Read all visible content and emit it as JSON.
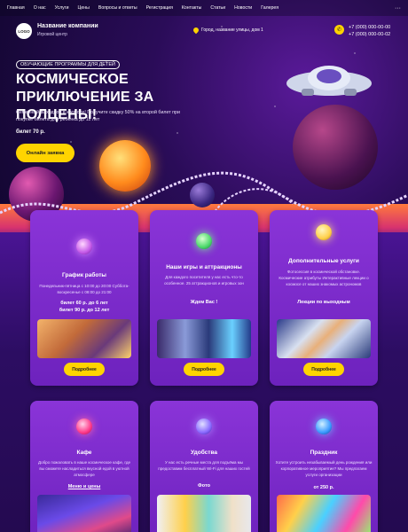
{
  "nav": {
    "items": [
      "Главная",
      "О нас",
      "Услуги",
      "Цены",
      "Вопросы и ответы",
      "Регистрация",
      "Контакты",
      "Статьи",
      "Новости",
      "Галерея"
    ],
    "more": "···"
  },
  "header": {
    "logo": "LOGO",
    "company_name": "Название компании",
    "company_sub": "Игровой центр",
    "address": "Город, название улицы, дом 1",
    "phone_1": "+7 (000) 000-00-00",
    "phone_2": "+7 (000) 000-00-02"
  },
  "hero": {
    "badge": "ОБУЧАЮЩИЕ ПРОГРАММЫ ДЛЯ ДЕТЕЙ",
    "title": "КОСМИЧЕСКОЕ ПРИКЛЮЧЕНИЕ ЗА ПОЛЦЕНЫ!",
    "description": "Семейный выходной в космосе! Получите скидку 50% на второй билет при покупке билета для ребенка до 12 лет",
    "price": "билет 70 р.",
    "cta": "Онлайн заявка"
  },
  "cards": [
    {
      "title": "График работы",
      "text": "Понедельник-пятница с 10:00 до 20:00 Суббота-воскресенье с 08:00 до 21:00",
      "strong": [
        "билет 60 р. до 6 лет",
        "билет 90 р. до 12 лет"
      ],
      "button": "Подробнее"
    },
    {
      "title": "Наши игры и аттракционы",
      "text": "Для каждого посетителя у нас есть что-то особенное. 25 аттракционов и игровых зон",
      "strong": [
        "Ждем Вас !"
      ],
      "button": "Подробнее"
    },
    {
      "title": "Дополнительные услуги",
      "text": "Фотосессия в космической обстановке. Космические атрибуты Интерактивные лекции о космосе от наших знакомых астрономов",
      "strong": [
        "Лекции по выходным"
      ],
      "button": "Подробнее"
    },
    {
      "title": "Кафе",
      "text": "Добро пожаловать в наше космическое кафе, где вы сможете насладиться вкусной едой в уютной атмосфере",
      "link": "Меню и цены"
    },
    {
      "title": "Удобства",
      "text": "У нас есть речные места для подъёма мы предоставим бесплатный Wi-Fi для наших гостей",
      "strong": [
        "Фото"
      ]
    },
    {
      "title": "Праздник",
      "text": "Хотите устроить незабываемый день рождения или корпоративное мероприятие? Мы предлагаем услуги организации",
      "strong": [
        "от 250 р."
      ]
    }
  ],
  "colors": {
    "accent": "#ffd400",
    "card": "#7a2acb",
    "background": "#2a0f5c"
  }
}
